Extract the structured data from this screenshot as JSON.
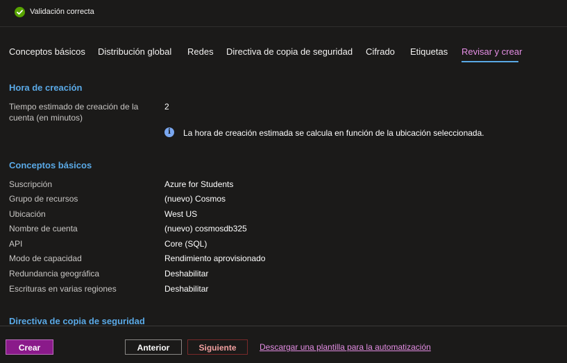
{
  "banner": {
    "text": "Validación correcta",
    "icon": "check-circle-icon",
    "icon_color": "#57a300"
  },
  "tabs": [
    {
      "label": "Conceptos básicos"
    },
    {
      "label": "Distribución global"
    },
    {
      "label": "Redes"
    },
    {
      "label": "Directiva de copia de seguridad"
    },
    {
      "label": "Cifrado"
    },
    {
      "label": "Etiquetas"
    },
    {
      "label": "Revisar y crear",
      "active": true
    }
  ],
  "creation_time": {
    "title": "Hora de creación",
    "label": "Tiempo estimado de creación de la cuenta (en minutos)",
    "value": "2",
    "info": "La hora de creación estimada se calcula en función de la ubicación seleccionada.",
    "info_icon": "info-icon"
  },
  "basics": {
    "title": "Conceptos básicos",
    "rows": [
      {
        "label": "Suscripción",
        "value": "Azure for Students"
      },
      {
        "label": "Grupo de recursos",
        "value": "(nuevo) Cosmos"
      },
      {
        "label": "Ubicación",
        "value": "West US"
      },
      {
        "label": "Nombre de cuenta",
        "value": "(nuevo) cosmosdb325"
      },
      {
        "label": "API",
        "value": "Core (SQL)"
      },
      {
        "label": "Modo de capacidad",
        "value": "Rendimiento aprovisionado"
      },
      {
        "label": "Redundancia geográfica",
        "value": "Deshabilitar"
      },
      {
        "label": "Escrituras en varias regiones",
        "value": "Deshabilitar"
      }
    ]
  },
  "backup": {
    "title": "Directiva de copia de seguridad"
  },
  "footer": {
    "create_label": "Crear",
    "previous_label": "Anterior",
    "next_label": "Siguiente",
    "template_link": "Descargar una plantilla para la automatización"
  },
  "colors": {
    "accent": "#5aa9e6",
    "active_tab": "#e58ee5",
    "create_button": "#8a1a8a",
    "background": "#1b1a19"
  }
}
